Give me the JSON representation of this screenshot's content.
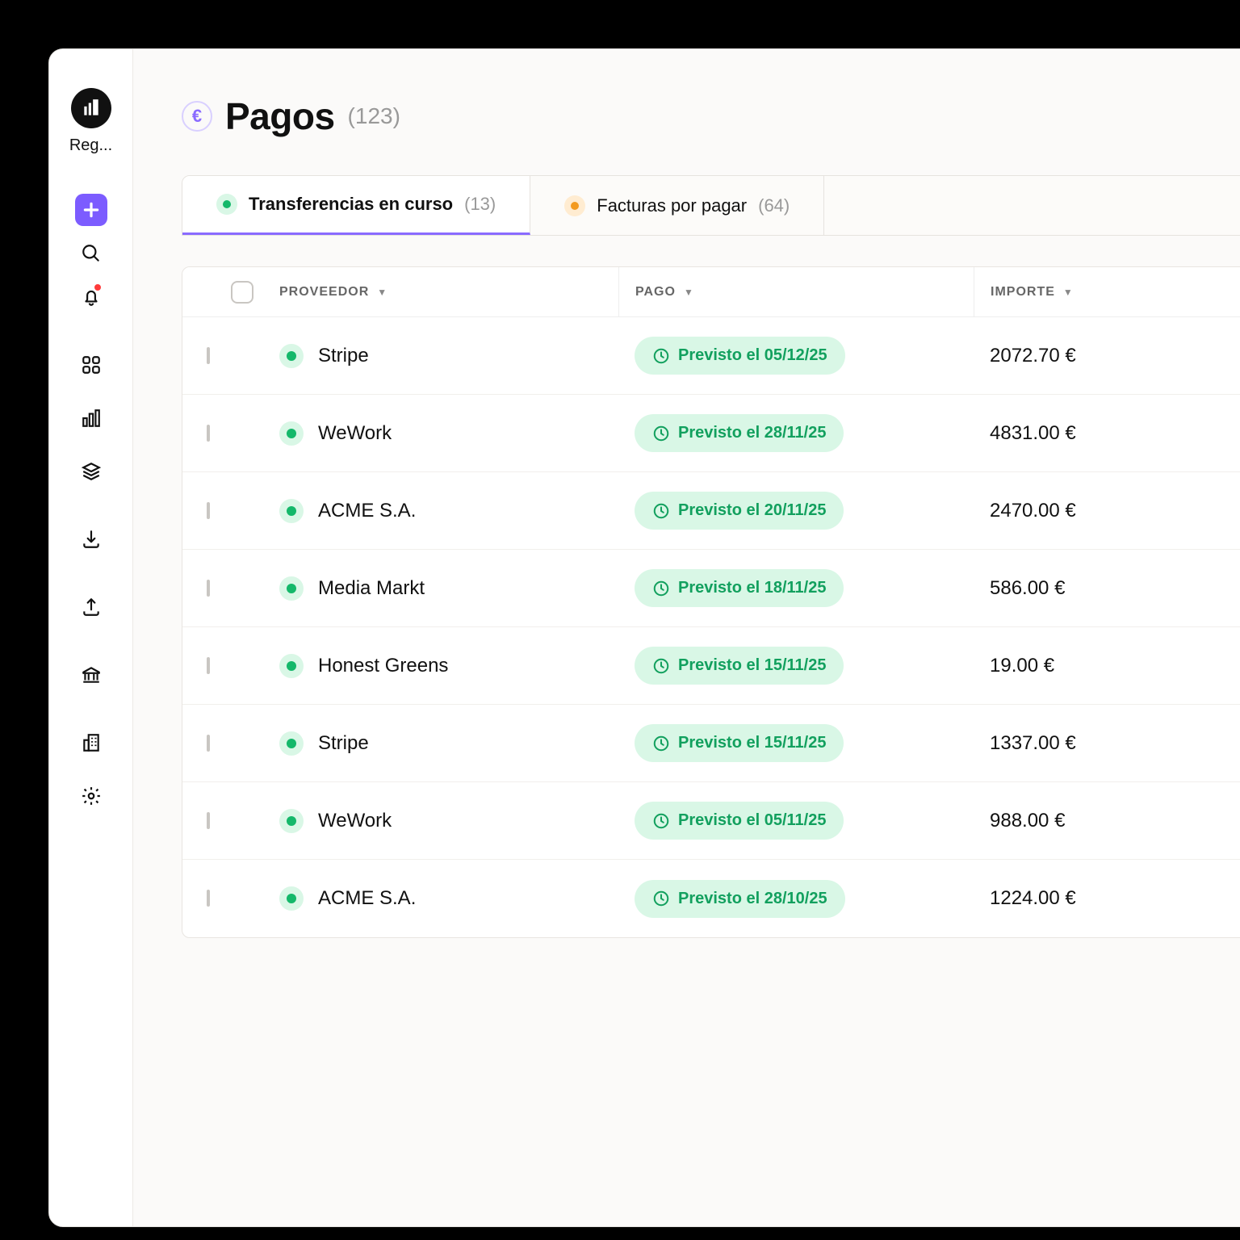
{
  "sidebar": {
    "logo_label": "Reg..."
  },
  "header": {
    "title": "Pagos",
    "count_display": "(123)",
    "currency_symbol": "€"
  },
  "tabs": [
    {
      "label": "Transferencias en curso",
      "count_display": "(13)",
      "color": "green",
      "active": true
    },
    {
      "label": "Facturas por pagar",
      "count_display": "(64)",
      "color": "orange",
      "active": false
    }
  ],
  "columns": {
    "provider": "PROVEEDOR",
    "payment": "PAGO",
    "amount": "IMPORTE"
  },
  "rows": [
    {
      "vendor": "Stripe",
      "payment": "Previsto el 05/12/25",
      "amount": "2072.70 €"
    },
    {
      "vendor": "WeWork",
      "payment": "Previsto el 28/11/25",
      "amount": "4831.00 €"
    },
    {
      "vendor": "ACME S.A.",
      "payment": "Previsto el 20/11/25",
      "amount": "2470.00 €"
    },
    {
      "vendor": "Media Markt",
      "payment": "Previsto el 18/11/25",
      "amount": "586.00 €"
    },
    {
      "vendor": "Honest Greens",
      "payment": "Previsto el 15/11/25",
      "amount": "19.00 €"
    },
    {
      "vendor": "Stripe",
      "payment": "Previsto el 15/11/25",
      "amount": "1337.00 €"
    },
    {
      "vendor": "WeWork",
      "payment": "Previsto el 05/11/25",
      "amount": "988.00 €"
    },
    {
      "vendor": "ACME S.A.",
      "payment": "Previsto el 28/10/25",
      "amount": "1224.00 €"
    }
  ]
}
